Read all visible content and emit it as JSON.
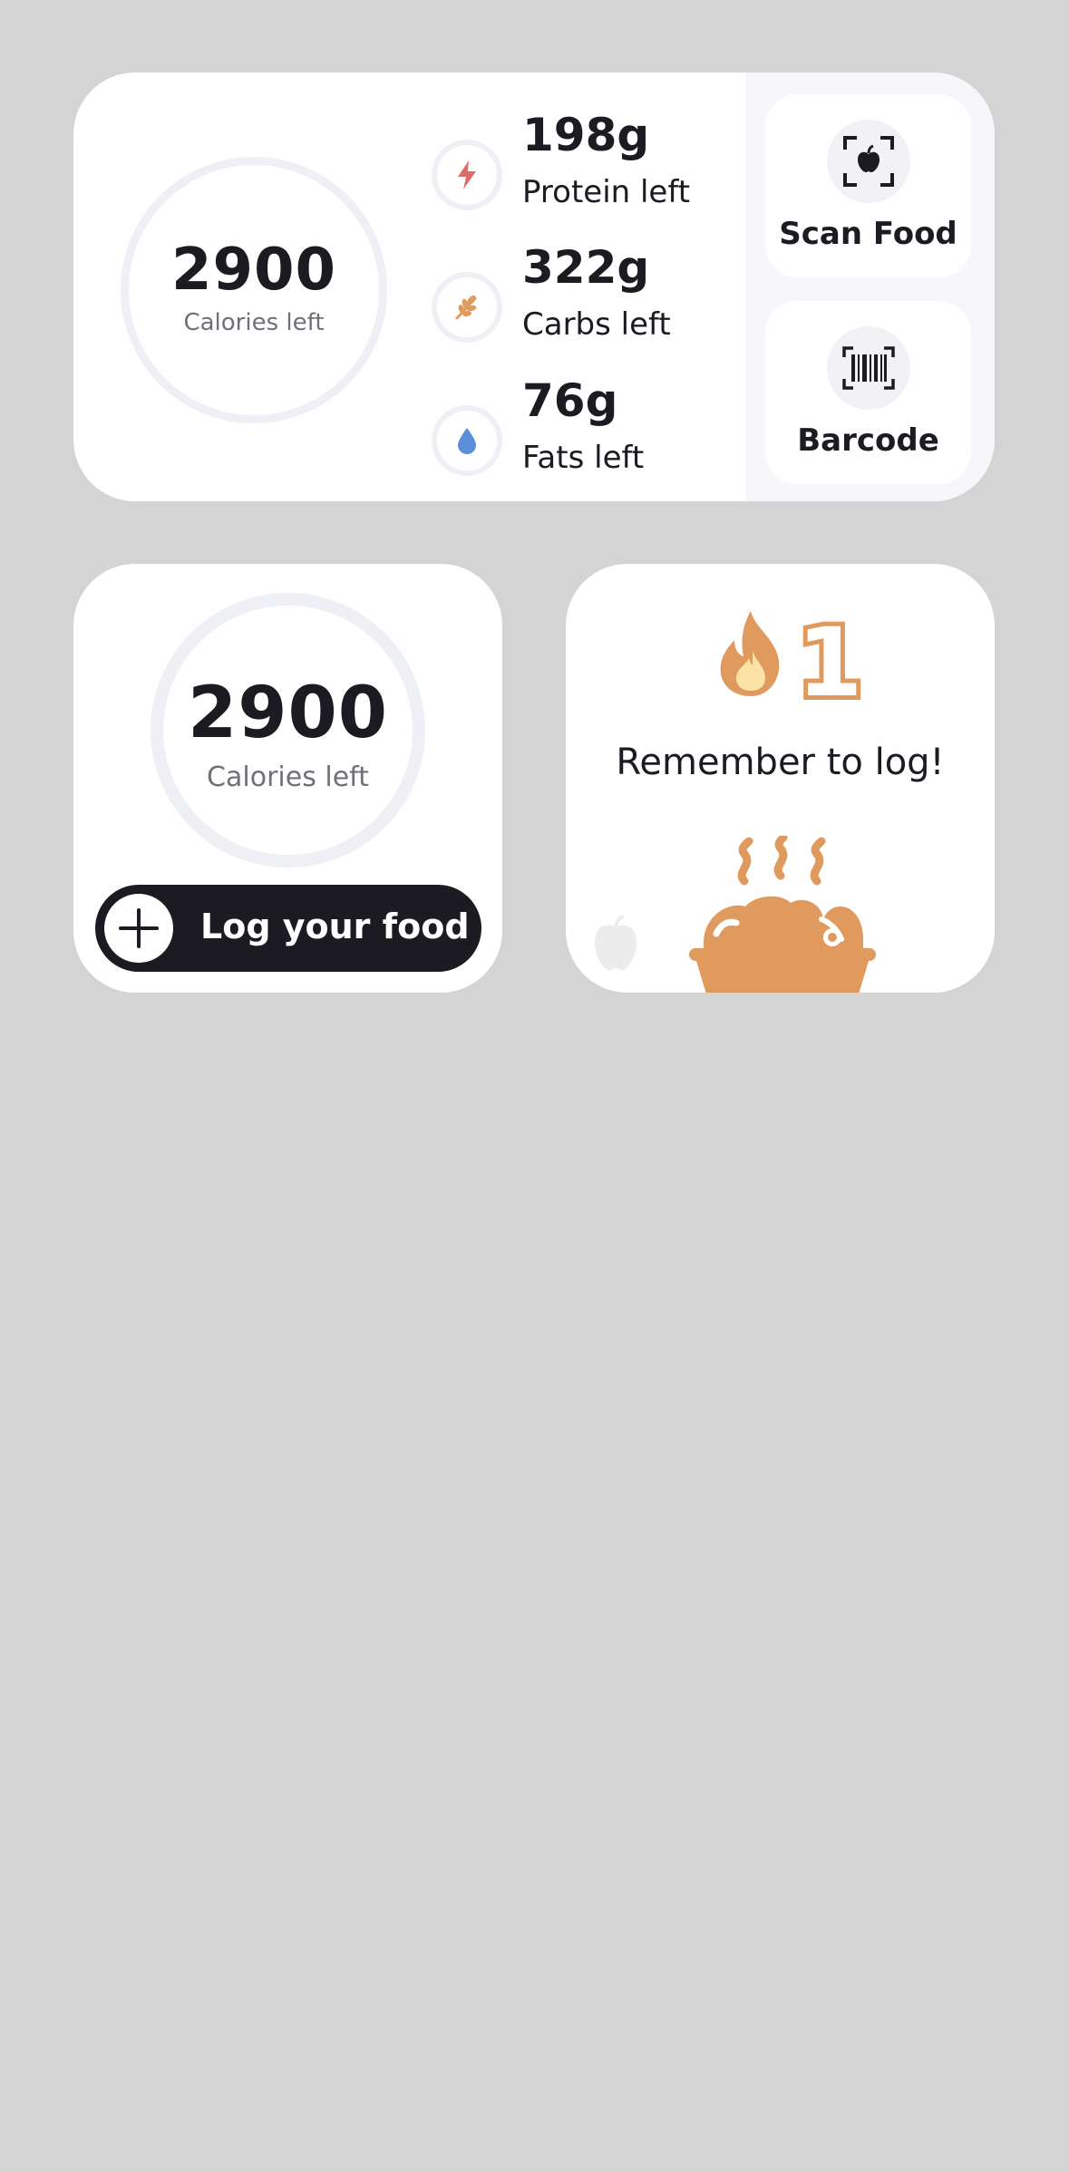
{
  "calories_widget": {
    "calories_value": "2900",
    "calories_label": "Calories left",
    "macros": [
      {
        "value": "198g",
        "label": "Protein left",
        "icon": "lightning-icon",
        "color": "#e06b6b"
      },
      {
        "value": "322g",
        "label": "Carbs left",
        "icon": "wheat-icon",
        "color": "#e09a5e"
      },
      {
        "value": "76g",
        "label": "Fats left",
        "icon": "droplet-icon",
        "color": "#5b8fdb"
      }
    ],
    "actions": [
      {
        "label": "Scan Food",
        "icon": "scan-food-icon"
      },
      {
        "label": "Barcode",
        "icon": "barcode-icon"
      }
    ]
  },
  "log_widget": {
    "calories_value": "2900",
    "calories_label": "Calories left",
    "button_label": "Log your food",
    "button_icon": "plus-icon"
  },
  "streak_widget": {
    "streak_count": "1",
    "message": "Remember to log!",
    "accent": "#e09a5e",
    "icons": [
      "flame-icon",
      "apple-icon",
      "food-bowl-icon"
    ]
  }
}
